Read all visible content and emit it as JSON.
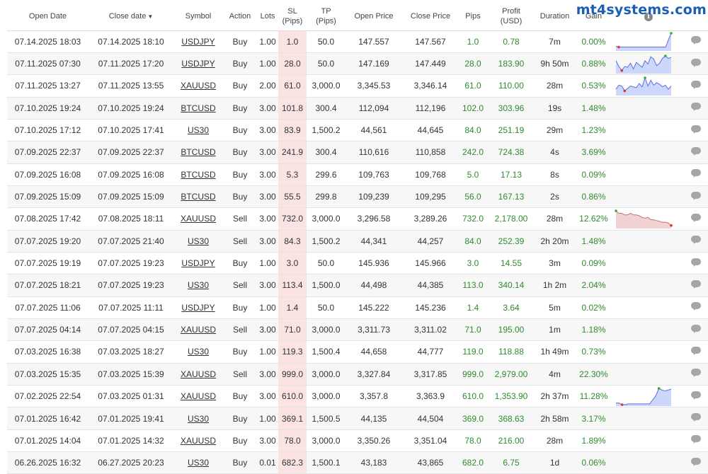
{
  "watermark": "mt4systems.com",
  "headers": {
    "open_date": "Open Date",
    "close_date": "Close date",
    "sort_indicator": "▼",
    "symbol": "Symbol",
    "action": "Action",
    "lots": "Lots",
    "sl_line1": "SL",
    "sl_line2": "(Pips)",
    "tp_line1": "TP",
    "tp_line2": "(Pips)",
    "open_price": "Open Price",
    "close_price": "Close Price",
    "pips": "Pips",
    "profit_line1": "Profit",
    "profit_line2": "(USD)",
    "duration": "Duration",
    "gain": "Gain",
    "info": "i"
  },
  "colors": {
    "positive": "#2e8b2e",
    "sl_highlight": "#fbe3e3",
    "spark_up_fill": "#cdd6fb",
    "spark_up_line": "#5a6fe0",
    "spark_down_fill": "#f1d2d2",
    "spark_down_line": "#c47070"
  },
  "trades": [
    {
      "open": "07.14.2025 18:03",
      "close": "07.14.2025 18:10",
      "symbol": "USDJPY",
      "action": "Buy",
      "lots": "1.00",
      "sl": "1.0",
      "tp": "50.0",
      "open_price": "147.557",
      "close_price": "147.567",
      "pips": "1.0",
      "profit": "0.78",
      "duration": "7m",
      "gain": "0.00%",
      "spark": {
        "dir": "up",
        "values": [
          0.2,
          0.15,
          0.15,
          0.15,
          0.15,
          0.15,
          0.15,
          0.15,
          0.15,
          0.15,
          0.15,
          0.15,
          0.15,
          0.15,
          0.15,
          0.15,
          0.15,
          0.15,
          0.15,
          0.6,
          1.0
        ]
      }
    },
    {
      "open": "07.11.2025 07:30",
      "close": "07.11.2025 17:20",
      "symbol": "USDJPY",
      "action": "Buy",
      "lots": "1.00",
      "sl": "28.0",
      "tp": "50.0",
      "open_price": "147.169",
      "close_price": "147.449",
      "pips": "28.0",
      "profit": "183.90",
      "duration": "9h 50m",
      "gain": "0.88%",
      "spark": {
        "dir": "up",
        "values": [
          0.7,
          0.35,
          0.1,
          0.35,
          0.3,
          0.55,
          0.2,
          0.6,
          0.45,
          0.3,
          0.7,
          0.5,
          0.95,
          0.8,
          0.4,
          0.55,
          0.85,
          1.0,
          0.85,
          0.9
        ]
      }
    },
    {
      "open": "07.11.2025 13:27",
      "close": "07.11.2025 13:55",
      "symbol": "XAUUSD",
      "action": "Buy",
      "lots": "2.00",
      "sl": "61.0",
      "tp": "3,000.0",
      "open_price": "3,345.53",
      "close_price": "3,346.14",
      "pips": "61.0",
      "profit": "110.00",
      "duration": "28m",
      "gain": "0.53%",
      "spark": {
        "dir": "up",
        "values": [
          0.3,
          0.55,
          0.5,
          0.2,
          0.35,
          0.5,
          0.45,
          0.4,
          0.65,
          0.45,
          1.0,
          0.5,
          0.85,
          0.55,
          0.7,
          0.6,
          0.45,
          0.55,
          0.3,
          0.5
        ]
      }
    },
    {
      "open": "07.10.2025 19:24",
      "close": "07.10.2025 19:24",
      "symbol": "BTCUSD",
      "action": "Buy",
      "lots": "3.00",
      "sl": "101.8",
      "tp": "300.4",
      "open_price": "112,094",
      "close_price": "112,196",
      "pips": "102.0",
      "profit": "303.96",
      "duration": "19s",
      "gain": "1.48%",
      "spark": null
    },
    {
      "open": "07.10.2025 17:12",
      "close": "07.10.2025 17:41",
      "symbol": "US30",
      "action": "Buy",
      "lots": "3.00",
      "sl": "83.9",
      "tp": "1,500.2",
      "open_price": "44,561",
      "close_price": "44,645",
      "pips": "84.0",
      "profit": "251.19",
      "duration": "29m",
      "gain": "1.23%",
      "spark": null
    },
    {
      "open": "07.09.2025 22:37",
      "close": "07.09.2025 22:37",
      "symbol": "BTCUSD",
      "action": "Buy",
      "lots": "3.00",
      "sl": "241.9",
      "tp": "300.4",
      "open_price": "110,616",
      "close_price": "110,858",
      "pips": "242.0",
      "profit": "724.38",
      "duration": "4s",
      "gain": "3.69%",
      "spark": null
    },
    {
      "open": "07.09.2025 16:08",
      "close": "07.09.2025 16:08",
      "symbol": "BTCUSD",
      "action": "Buy",
      "lots": "3.00",
      "sl": "5.3",
      "tp": "299.6",
      "open_price": "109,763",
      "close_price": "109,768",
      "pips": "5.0",
      "profit": "17.13",
      "duration": "8s",
      "gain": "0.09%",
      "spark": null
    },
    {
      "open": "07.09.2025 15:09",
      "close": "07.09.2025 15:09",
      "symbol": "BTCUSD",
      "action": "Buy",
      "lots": "3.00",
      "sl": "55.5",
      "tp": "299.8",
      "open_price": "109,239",
      "close_price": "109,295",
      "pips": "56.0",
      "profit": "167.13",
      "duration": "2s",
      "gain": "0.86%",
      "spark": null
    },
    {
      "open": "07.08.2025 17:42",
      "close": "07.08.2025 18:11",
      "symbol": "XAUUSD",
      "action": "Sell",
      "lots": "3.00",
      "sl": "732.0",
      "tp": "3,000.0",
      "open_price": "3,296.58",
      "close_price": "3,289.26",
      "pips": "732.0",
      "profit": "2,178.00",
      "duration": "28m",
      "gain": "12.62%",
      "spark": {
        "dir": "down",
        "values": [
          1.0,
          0.85,
          0.85,
          0.75,
          0.75,
          0.85,
          0.75,
          0.75,
          0.7,
          0.6,
          0.55,
          0.6,
          0.45,
          0.45,
          0.4,
          0.35,
          0.3,
          0.3,
          0.25,
          0.1
        ]
      }
    },
    {
      "open": "07.07.2025 19:20",
      "close": "07.07.2025 21:40",
      "symbol": "US30",
      "action": "Sell",
      "lots": "3.00",
      "sl": "84.3",
      "tp": "1,500.2",
      "open_price": "44,341",
      "close_price": "44,257",
      "pips": "84.0",
      "profit": "252.39",
      "duration": "2h 20m",
      "gain": "1.48%",
      "spark": null
    },
    {
      "open": "07.07.2025 19:19",
      "close": "07.07.2025 19:23",
      "symbol": "USDJPY",
      "action": "Buy",
      "lots": "1.00",
      "sl": "3.0",
      "tp": "50.0",
      "open_price": "145.936",
      "close_price": "145.966",
      "pips": "3.0",
      "profit": "14.55",
      "duration": "3m",
      "gain": "0.09%",
      "spark": null
    },
    {
      "open": "07.07.2025 18:21",
      "close": "07.07.2025 19:23",
      "symbol": "US30",
      "action": "Sell",
      "lots": "3.00",
      "sl": "113.4",
      "tp": "1,500.0",
      "open_price": "44,498",
      "close_price": "44,385",
      "pips": "113.0",
      "profit": "340.14",
      "duration": "1h 2m",
      "gain": "2.04%",
      "spark": null
    },
    {
      "open": "07.07.2025 11:06",
      "close": "07.07.2025 11:11",
      "symbol": "USDJPY",
      "action": "Buy",
      "lots": "1.00",
      "sl": "1.4",
      "tp": "50.0",
      "open_price": "145.222",
      "close_price": "145.236",
      "pips": "1.4",
      "profit": "3.64",
      "duration": "5m",
      "gain": "0.02%",
      "spark": null
    },
    {
      "open": "07.07.2025 04:14",
      "close": "07.07.2025 04:15",
      "symbol": "XAUUSD",
      "action": "Sell",
      "lots": "3.00",
      "sl": "71.0",
      "tp": "3,000.0",
      "open_price": "3,311.73",
      "close_price": "3,311.02",
      "pips": "71.0",
      "profit": "195.00",
      "duration": "1m",
      "gain": "1.18%",
      "spark": null
    },
    {
      "open": "07.03.2025 16:38",
      "close": "07.03.2025 18:27",
      "symbol": "US30",
      "action": "Buy",
      "lots": "1.00",
      "sl": "119.3",
      "tp": "1,500.4",
      "open_price": "44,658",
      "close_price": "44,777",
      "pips": "119.0",
      "profit": "118.88",
      "duration": "1h 49m",
      "gain": "0.73%",
      "spark": null
    },
    {
      "open": "07.03.2025 15:35",
      "close": "07.03.2025 15:39",
      "symbol": "XAUUSD",
      "action": "Sell",
      "lots": "3.00",
      "sl": "999.0",
      "tp": "3,000.0",
      "open_price": "3,327.84",
      "close_price": "3,317.85",
      "pips": "999.0",
      "profit": "2,979.00",
      "duration": "4m",
      "gain": "22.30%",
      "spark": null
    },
    {
      "open": "07.02.2025 22:54",
      "close": "07.03.2025 01:31",
      "symbol": "XAUUSD",
      "action": "Buy",
      "lots": "3.00",
      "sl": "610.0",
      "tp": "3,000.0",
      "open_price": "3,357.8",
      "close_price": "3,363.9",
      "pips": "610.0",
      "profit": "1,353.90",
      "duration": "2h 37m",
      "gain": "11.28%",
      "spark": {
        "dir": "up",
        "values": [
          0.1,
          0.1,
          0.0,
          0.0,
          0.05,
          0.05,
          0.05,
          0.05,
          0.05,
          0.05,
          0.05,
          0.05,
          0.3,
          0.55,
          1.0,
          0.9,
          0.85,
          0.9,
          0.95
        ]
      }
    },
    {
      "open": "07.01.2025 16:42",
      "close": "07.01.2025 19:41",
      "symbol": "US30",
      "action": "Buy",
      "lots": "1.00",
      "sl": "369.1",
      "tp": "1,500.5",
      "open_price": "44,135",
      "close_price": "44,504",
      "pips": "369.0",
      "profit": "368.63",
      "duration": "2h 58m",
      "gain": "3.17%",
      "spark": null
    },
    {
      "open": "07.01.2025 14:04",
      "close": "07.01.2025 14:32",
      "symbol": "XAUUSD",
      "action": "Buy",
      "lots": "3.00",
      "sl": "78.0",
      "tp": "3,000.0",
      "open_price": "3,350.26",
      "close_price": "3,351.04",
      "pips": "78.0",
      "profit": "216.00",
      "duration": "28m",
      "gain": "1.89%",
      "spark": null
    },
    {
      "open": "06.26.2025 16:32",
      "close": "06.27.2025 20:23",
      "symbol": "US30",
      "action": "Buy",
      "lots": "0.01",
      "sl": "682.3",
      "tp": "1,500.1",
      "open_price": "43,183",
      "close_price": "43,865",
      "pips": "682.0",
      "profit": "6.75",
      "duration": "1d",
      "gain": "0.06%",
      "spark": null
    }
  ]
}
